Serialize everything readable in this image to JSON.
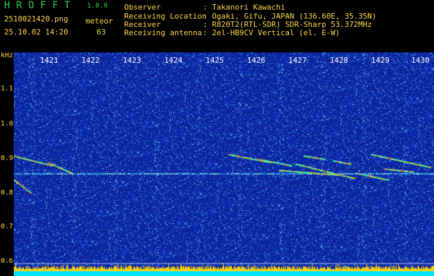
{
  "header": {
    "app_title": "HROFFT",
    "app_version": "1.0.0",
    "filename": "2510021420.png",
    "meteor_label": "meteor",
    "datetime": "25.10.02 14:20",
    "meteor_count": "63"
  },
  "station_info": [
    {
      "label": "Observer",
      "value": "Takanori Kawachi"
    },
    {
      "label": "Receiving Location",
      "value": "Ogaki, Gifu, JAPAN (136.60E, 35.35N)"
    },
    {
      "label": "Receiver",
      "value": "R820T2(RTL-SDR) SDR-Sharp 53.372MHz"
    },
    {
      "label": "Receiving antenna",
      "value": "2el-HB9CV Vertical (el. E-W)"
    }
  ],
  "chart_data": {
    "type": "heatmap",
    "y_unit": "kHz",
    "y_ticks": [
      "1.1",
      "1.0",
      "0.9",
      "0.8",
      "0.7",
      "0.6"
    ],
    "ylim": [
      0.58,
      1.2
    ],
    "x_ticks": [
      "1421",
      "1422",
      "1423",
      "1424",
      "1425",
      "1426",
      "1427",
      "1428",
      "1429",
      "1430"
    ],
    "xlim_minutes": [
      1420.6,
      1430.6
    ],
    "carrier_khz": 0.9,
    "reference_lines_khz": [
      0.62,
      0.6
    ],
    "meteor_echoes": [
      {
        "start": [
          1420.6,
          0.955
        ],
        "end": [
          1421.5,
          0.925
        ]
      },
      {
        "start": [
          1421.4,
          0.935
        ],
        "end": [
          1422.0,
          0.9
        ]
      },
      {
        "start": [
          1420.6,
          0.88
        ],
        "end": [
          1421.0,
          0.84
        ]
      },
      {
        "start": [
          1425.7,
          0.96
        ],
        "end": [
          1426.7,
          0.935
        ]
      },
      {
        "start": [
          1426.4,
          0.945
        ],
        "end": [
          1427.2,
          0.925
        ]
      },
      {
        "start": [
          1427.3,
          0.93
        ],
        "end": [
          1428.7,
          0.885
        ]
      },
      {
        "start": [
          1426.9,
          0.91
        ],
        "end": [
          1428.4,
          0.895
        ]
      },
      {
        "start": [
          1427.5,
          0.955
        ],
        "end": [
          1428.0,
          0.945
        ]
      },
      {
        "start": [
          1428.2,
          0.94
        ],
        "end": [
          1428.6,
          0.93
        ]
      },
      {
        "start": [
          1429.1,
          0.96
        ],
        "end": [
          1430.5,
          0.92
        ]
      },
      {
        "start": [
          1428.8,
          0.9
        ],
        "end": [
          1429.5,
          0.88
        ]
      },
      {
        "start": [
          1429.4,
          0.915
        ],
        "end": [
          1430.1,
          0.905
        ]
      }
    ],
    "colors": {
      "background": "#0a1d9c",
      "text": "#ffd84a",
      "title": "#2fd24a",
      "signal_hot": "#ff4040",
      "signal_warm": "#ffd000",
      "signal_cool": "#40ffb0",
      "noise_floor": "#00e5ff"
    }
  }
}
